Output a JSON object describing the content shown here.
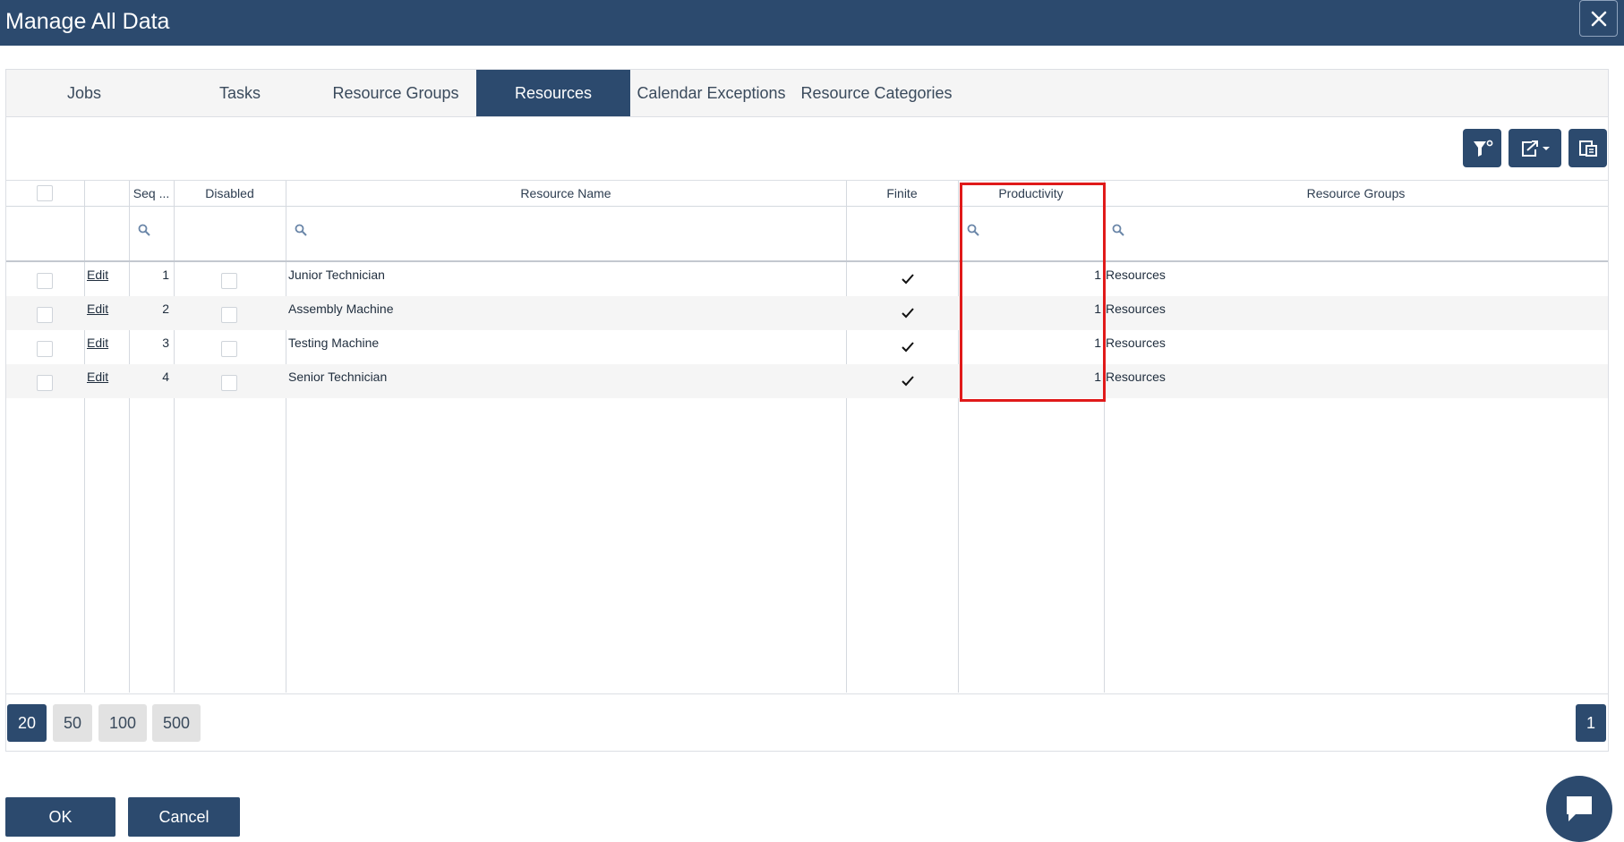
{
  "window": {
    "title": "Manage All Data",
    "close_icon": "close-icon"
  },
  "tabs": [
    {
      "label": "Jobs",
      "active": false
    },
    {
      "label": "Tasks",
      "active": false
    },
    {
      "label": "Resource Groups",
      "active": false
    },
    {
      "label": "Resources",
      "active": true
    },
    {
      "label": "Calendar Exceptions",
      "active": false
    },
    {
      "label": "Resource Categories",
      "active": false
    }
  ],
  "toolbar": {
    "icons": [
      "filter-clear-icon",
      "export-icon",
      "column-chooser-icon"
    ]
  },
  "grid": {
    "columns": [
      "",
      "",
      "Seq ...",
      "Disabled",
      "Resource Name",
      "Finite",
      "Productivity",
      "Resource Groups"
    ],
    "edit_label": "Edit",
    "rows": [
      {
        "seq": "1",
        "disabled": false,
        "name": "Junior Technician",
        "finite": true,
        "productivity": "1",
        "groups": "Resources"
      },
      {
        "seq": "2",
        "disabled": false,
        "name": "Assembly Machine",
        "finite": true,
        "productivity": "1",
        "groups": "Resources"
      },
      {
        "seq": "3",
        "disabled": false,
        "name": "Testing Machine",
        "finite": true,
        "productivity": "1",
        "groups": "Resources"
      },
      {
        "seq": "4",
        "disabled": false,
        "name": "Senior Technician",
        "finite": true,
        "productivity": "1",
        "groups": "Resources"
      }
    ]
  },
  "pager": {
    "sizes": [
      "20",
      "50",
      "100",
      "500"
    ],
    "selected_size": "20",
    "current_page": "1"
  },
  "footer": {
    "ok_label": "OK",
    "cancel_label": "Cancel"
  },
  "colors": {
    "primary": "#2c4a6e",
    "highlight": "#e01a1a"
  }
}
